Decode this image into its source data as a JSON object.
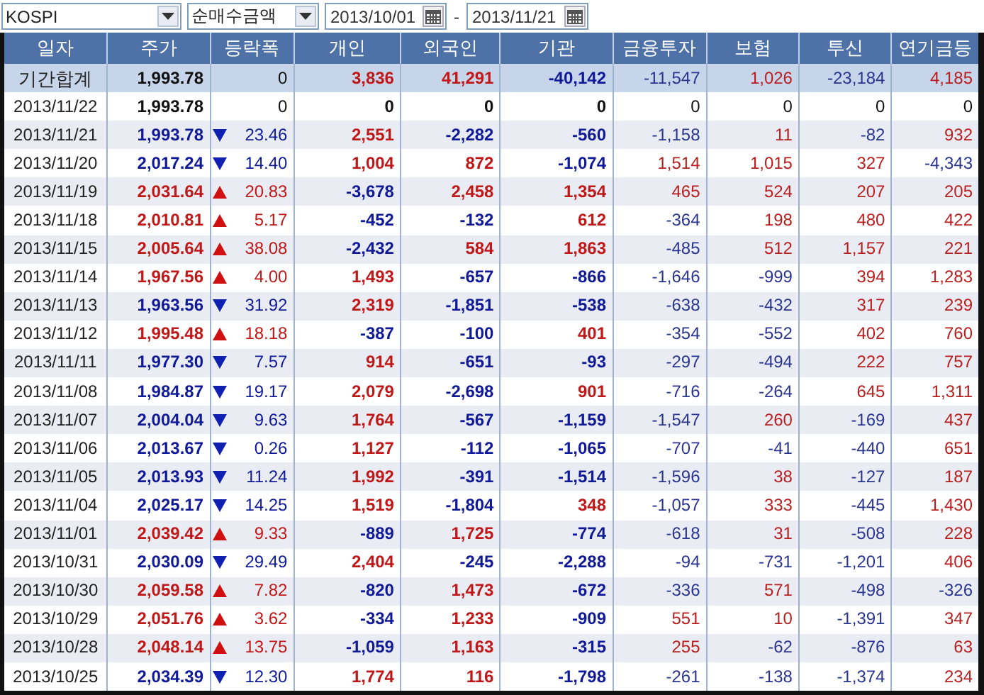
{
  "toolbar": {
    "market": "KOSPI",
    "mode": "순매수금액",
    "start_date": "2013/10/01",
    "separator": "-",
    "end_date": "2013/11/21"
  },
  "table": {
    "columns": [
      "일자",
      "주가",
      "등락폭",
      "개인",
      "외국인",
      "기관",
      "금융투자",
      "보험",
      "투신",
      "연기금등"
    ],
    "rows": [
      {
        "kind": "total",
        "date": "기간합계",
        "price": "1,993.78",
        "rising": false,
        "falling": false,
        "change": "0",
        "values": [
          "3,836",
          "41,291",
          "-40,142",
          "-11,547",
          "1,026",
          "-23,184",
          "4,185"
        ]
      },
      {
        "kind": "day",
        "date": "2013/11/22",
        "price": "1,993.78",
        "rising": false,
        "falling": false,
        "change": "0",
        "values": [
          "0",
          "0",
          "0",
          "0",
          "0",
          "0",
          "0"
        ]
      },
      {
        "kind": "day",
        "date": "2013/11/21",
        "price": "1,993.78",
        "rising": false,
        "falling": true,
        "change": "23.46",
        "values": [
          "2,551",
          "-2,282",
          "-560",
          "-1,158",
          "11",
          "-82",
          "932"
        ]
      },
      {
        "kind": "day",
        "date": "2013/11/20",
        "price": "2,017.24",
        "rising": false,
        "falling": true,
        "change": "14.40",
        "values": [
          "1,004",
          "872",
          "-1,074",
          "1,514",
          "1,015",
          "327",
          "-4,343"
        ]
      },
      {
        "kind": "day",
        "date": "2013/11/19",
        "price": "2,031.64",
        "rising": true,
        "falling": false,
        "change": "20.83",
        "values": [
          "-3,678",
          "2,458",
          "1,354",
          "465",
          "524",
          "207",
          "205"
        ]
      },
      {
        "kind": "day",
        "date": "2013/11/18",
        "price": "2,010.81",
        "rising": true,
        "falling": false,
        "change": "5.17",
        "values": [
          "-452",
          "-132",
          "612",
          "-364",
          "198",
          "480",
          "422"
        ]
      },
      {
        "kind": "day",
        "date": "2013/11/15",
        "price": "2,005.64",
        "rising": true,
        "falling": false,
        "change": "38.08",
        "values": [
          "-2,432",
          "584",
          "1,863",
          "-485",
          "512",
          "1,157",
          "221"
        ]
      },
      {
        "kind": "day",
        "date": "2013/11/14",
        "price": "1,967.56",
        "rising": true,
        "falling": false,
        "change": "4.00",
        "values": [
          "1,493",
          "-657",
          "-866",
          "-1,646",
          "-999",
          "394",
          "1,283"
        ]
      },
      {
        "kind": "day",
        "date": "2013/11/13",
        "price": "1,963.56",
        "rising": false,
        "falling": true,
        "change": "31.92",
        "values": [
          "2,319",
          "-1,851",
          "-538",
          "-638",
          "-432",
          "317",
          "239"
        ]
      },
      {
        "kind": "day",
        "date": "2013/11/12",
        "price": "1,995.48",
        "rising": true,
        "falling": false,
        "change": "18.18",
        "values": [
          "-387",
          "-100",
          "401",
          "-354",
          "-552",
          "402",
          "760"
        ]
      },
      {
        "kind": "day",
        "date": "2013/11/11",
        "price": "1,977.30",
        "rising": false,
        "falling": true,
        "change": "7.57",
        "values": [
          "914",
          "-651",
          "-93",
          "-297",
          "-494",
          "222",
          "757"
        ]
      },
      {
        "kind": "day",
        "date": "2013/11/08",
        "price": "1,984.87",
        "rising": false,
        "falling": true,
        "change": "19.17",
        "values": [
          "2,079",
          "-2,698",
          "901",
          "-716",
          "-264",
          "645",
          "1,311"
        ]
      },
      {
        "kind": "day",
        "date": "2013/11/07",
        "price": "2,004.04",
        "rising": false,
        "falling": true,
        "change": "9.63",
        "values": [
          "1,764",
          "-567",
          "-1,159",
          "-1,547",
          "260",
          "-169",
          "437"
        ]
      },
      {
        "kind": "day",
        "date": "2013/11/06",
        "price": "2,013.67",
        "rising": false,
        "falling": true,
        "change": "0.26",
        "values": [
          "1,127",
          "-112",
          "-1,065",
          "-707",
          "-41",
          "-440",
          "651"
        ]
      },
      {
        "kind": "day",
        "date": "2013/11/05",
        "price": "2,013.93",
        "rising": false,
        "falling": true,
        "change": "11.24",
        "values": [
          "1,992",
          "-391",
          "-1,514",
          "-1,596",
          "38",
          "-127",
          "187"
        ]
      },
      {
        "kind": "day",
        "date": "2013/11/04",
        "price": "2,025.17",
        "rising": false,
        "falling": true,
        "change": "14.25",
        "values": [
          "1,519",
          "-1,804",
          "348",
          "-1,057",
          "333",
          "-445",
          "1,430"
        ]
      },
      {
        "kind": "day",
        "date": "2013/11/01",
        "price": "2,039.42",
        "rising": true,
        "falling": false,
        "change": "9.33",
        "values": [
          "-889",
          "1,725",
          "-774",
          "-618",
          "31",
          "-508",
          "228"
        ]
      },
      {
        "kind": "day",
        "date": "2013/10/31",
        "price": "2,030.09",
        "rising": false,
        "falling": true,
        "change": "29.49",
        "values": [
          "2,404",
          "-245",
          "-2,288",
          "-94",
          "-731",
          "-1,201",
          "406"
        ]
      },
      {
        "kind": "day",
        "date": "2013/10/30",
        "price": "2,059.58",
        "rising": true,
        "falling": false,
        "change": "7.82",
        "values": [
          "-820",
          "1,473",
          "-672",
          "-336",
          "571",
          "-498",
          "-326"
        ]
      },
      {
        "kind": "day",
        "date": "2013/10/29",
        "price": "2,051.76",
        "rising": true,
        "falling": false,
        "change": "3.62",
        "values": [
          "-334",
          "1,233",
          "-909",
          "551",
          "10",
          "-1,391",
          "347"
        ]
      },
      {
        "kind": "day",
        "date": "2013/10/28",
        "price": "2,048.14",
        "rising": true,
        "falling": false,
        "change": "13.75",
        "values": [
          "-1,059",
          "1,163",
          "-315",
          "255",
          "-62",
          "-876",
          "63"
        ]
      },
      {
        "kind": "day",
        "date": "2013/10/25",
        "price": "2,034.39",
        "rising": false,
        "falling": true,
        "change": "12.30",
        "values": [
          "1,774",
          "116",
          "-1,798",
          "-261",
          "-138",
          "-1,374",
          "234"
        ]
      }
    ]
  }
}
